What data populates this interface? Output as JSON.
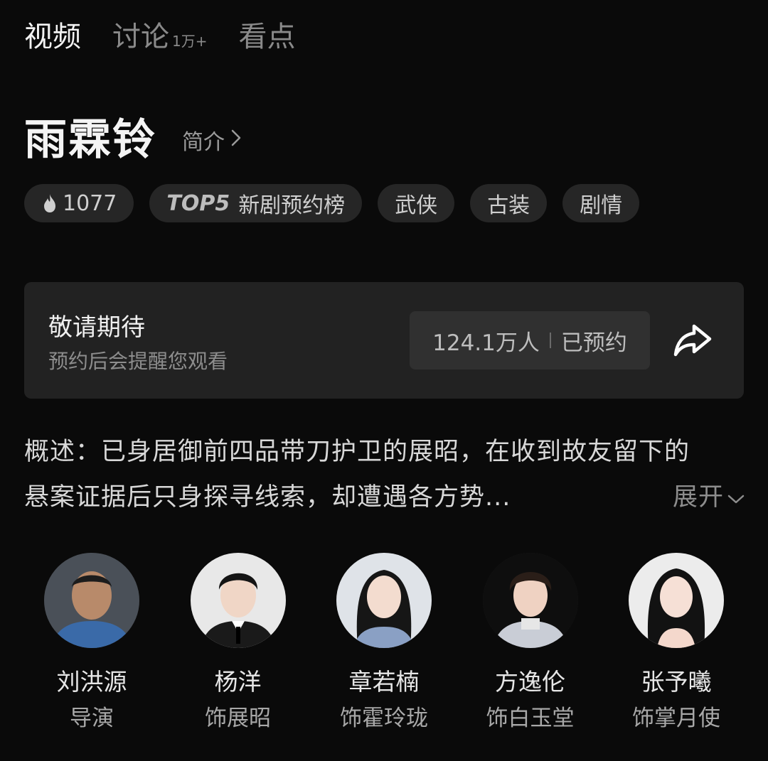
{
  "tabs": [
    {
      "label": "视频",
      "count": "",
      "active": true
    },
    {
      "label": "讨论",
      "count": "1万+",
      "active": false
    },
    {
      "label": "看点",
      "count": "",
      "active": false
    }
  ],
  "show": {
    "title": "雨霖铃",
    "intro_label": "简介"
  },
  "tags": {
    "heat": "1077",
    "rank_badge": "TOP5",
    "rank_list": "新剧预约榜",
    "genres": [
      "武侠",
      "古装",
      "剧情"
    ]
  },
  "reservation": {
    "title": "敬请期待",
    "subtitle": "预约后会提醒您观看",
    "count": "124.1万人",
    "status": "已预约"
  },
  "synopsis": {
    "line1": "概述：已身居御前四品带刀护卫的展昭，在收到故友留下的",
    "line2": "悬案证据后只身探寻线索，却遭遇各方势...",
    "expand_label": "展开"
  },
  "cast": [
    {
      "name": "刘洪源",
      "role": "导演"
    },
    {
      "name": "杨洋",
      "role": "饰展昭"
    },
    {
      "name": "章若楠",
      "role": "饰霍玲珑"
    },
    {
      "name": "方逸伦",
      "role": "饰白玉堂"
    },
    {
      "name": "张予曦",
      "role": "饰掌月使"
    }
  ],
  "colors": {
    "background": "#0a0a0a",
    "card": "#222222",
    "tag": "#262626",
    "text_primary": "#f2f2f2",
    "text_secondary": "#8d8d8d"
  }
}
